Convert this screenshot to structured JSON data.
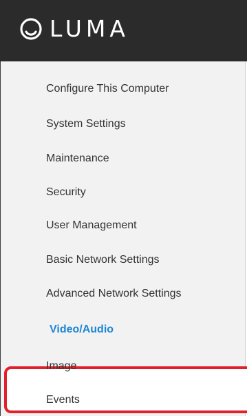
{
  "app": {
    "brand": "LUMA",
    "accent_color": "#1f86d4",
    "highlight_color": "#e0212b"
  },
  "sidebar": {
    "items": [
      {
        "label": "Configure This Computer",
        "active": false
      },
      {
        "label": "System Settings",
        "active": false
      },
      {
        "label": "Maintenance",
        "active": false
      },
      {
        "label": "Security",
        "active": false
      },
      {
        "label": "User Management",
        "active": false
      },
      {
        "label": "Basic Network Settings",
        "active": false
      },
      {
        "label": "Advanced Network Settings",
        "active": false
      },
      {
        "label": "Video/Audio",
        "active": true
      },
      {
        "label": "Image",
        "active": false
      },
      {
        "label": "Events",
        "active": false
      }
    ]
  }
}
